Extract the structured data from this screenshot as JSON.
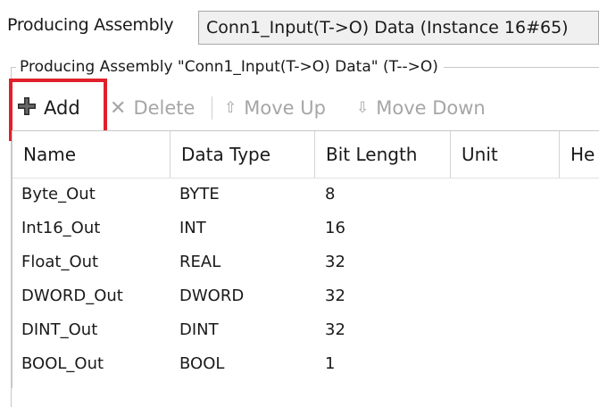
{
  "assembly": {
    "label": "Producing Assembly",
    "selected_value": "Conn1_Input(T->O) Data (Instance 16#65)"
  },
  "group": {
    "title": "Producing Assembly \"Conn1_Input(T->O) Data\" (T-->O)"
  },
  "toolbar": {
    "add_label": "Add",
    "delete_label": "Delete",
    "move_up_label": "Move Up",
    "move_down_label": "Move Down"
  },
  "table": {
    "columns": [
      "Name",
      "Data Type",
      "Bit Length",
      "Unit",
      "He"
    ],
    "rows": [
      {
        "name": "Byte_Out",
        "type": "BYTE",
        "bits": "8"
      },
      {
        "name": "Int16_Out",
        "type": "INT",
        "bits": "16"
      },
      {
        "name": "Float_Out",
        "type": "REAL",
        "bits": "32"
      },
      {
        "name": "DWORD_Out",
        "type": "DWORD",
        "bits": "32"
      },
      {
        "name": "DINT_Out",
        "type": "DINT",
        "bits": "32"
      },
      {
        "name": "BOOL_Out",
        "type": "BOOL",
        "bits": "1"
      }
    ]
  },
  "colors": {
    "highlight": "#e0202a",
    "disabled_text": "#a6a6a6"
  },
  "icons": {
    "add": "plus-icon",
    "delete": "x-icon",
    "move_up": "arrow-up-icon",
    "move_down": "arrow-down-icon"
  }
}
